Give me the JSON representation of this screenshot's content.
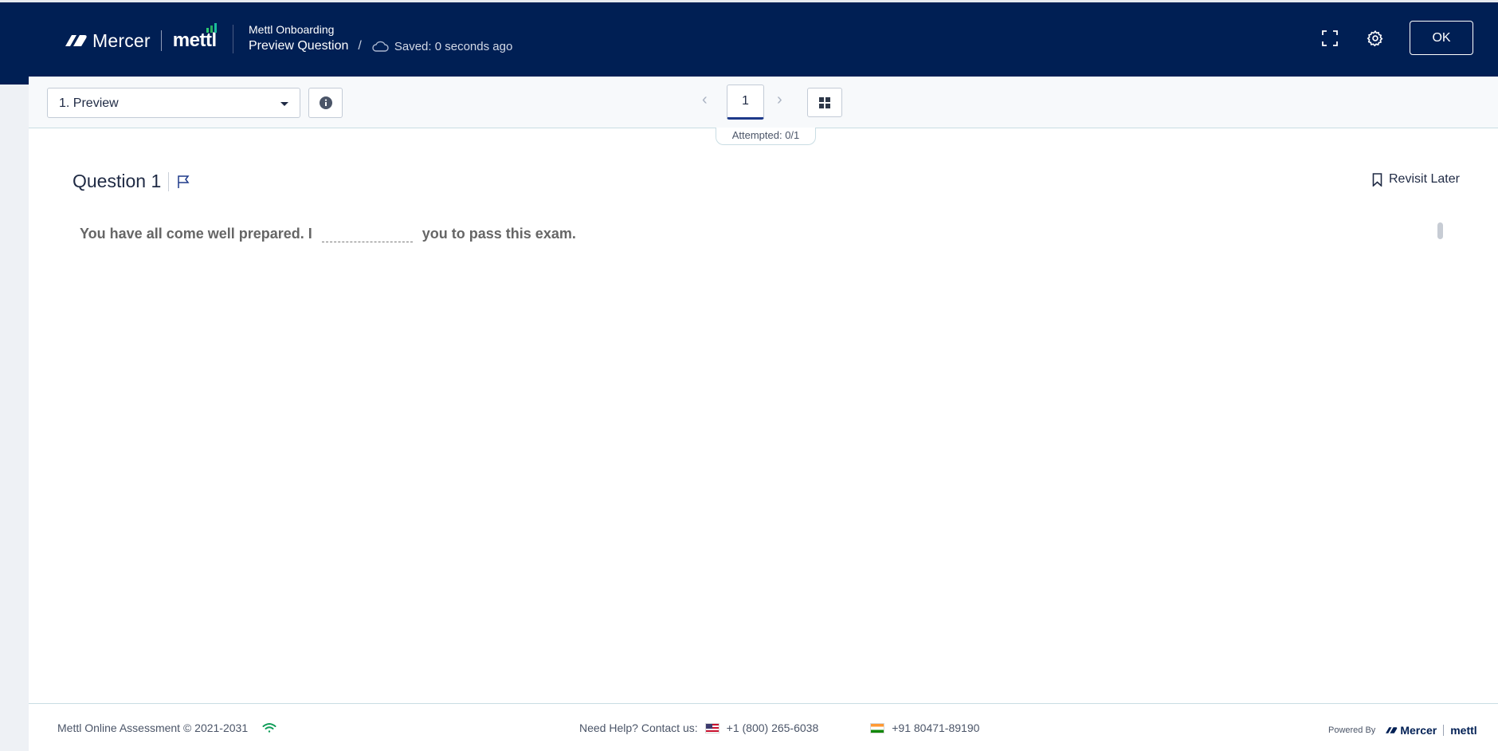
{
  "header": {
    "brand_mercer": "Mercer",
    "brand_mettl": "mettl",
    "subtitle": "Mettl Onboarding",
    "title": "Preview Question",
    "separator": "/",
    "saved_status": "Saved: 0 seconds ago",
    "ok_label": "OK"
  },
  "toolbar": {
    "section_select_value": "1. Preview",
    "current_page": "1",
    "prev_glyph": "‹",
    "next_glyph": "›",
    "attempted": "Attempted: 0/1"
  },
  "question": {
    "title": "Question 1",
    "revisit_label": "Revisit Later",
    "text_before": "You have all come well prepared. I",
    "text_after": "you to pass this exam."
  },
  "footer": {
    "copyright": "Mettl Online Assessment © 2021-2031",
    "help_label": "Need Help? Contact us:",
    "phone_us": "+1 (800) 265-6038",
    "phone_in": "+91 80471-89190",
    "powered_by": "Powered By",
    "powered_mercer": "Mercer",
    "powered_mettl": "mettl"
  },
  "colors": {
    "header_bg": "#001f54",
    "accent": "#1e3a8a",
    "wifi": "#0f9d58"
  }
}
